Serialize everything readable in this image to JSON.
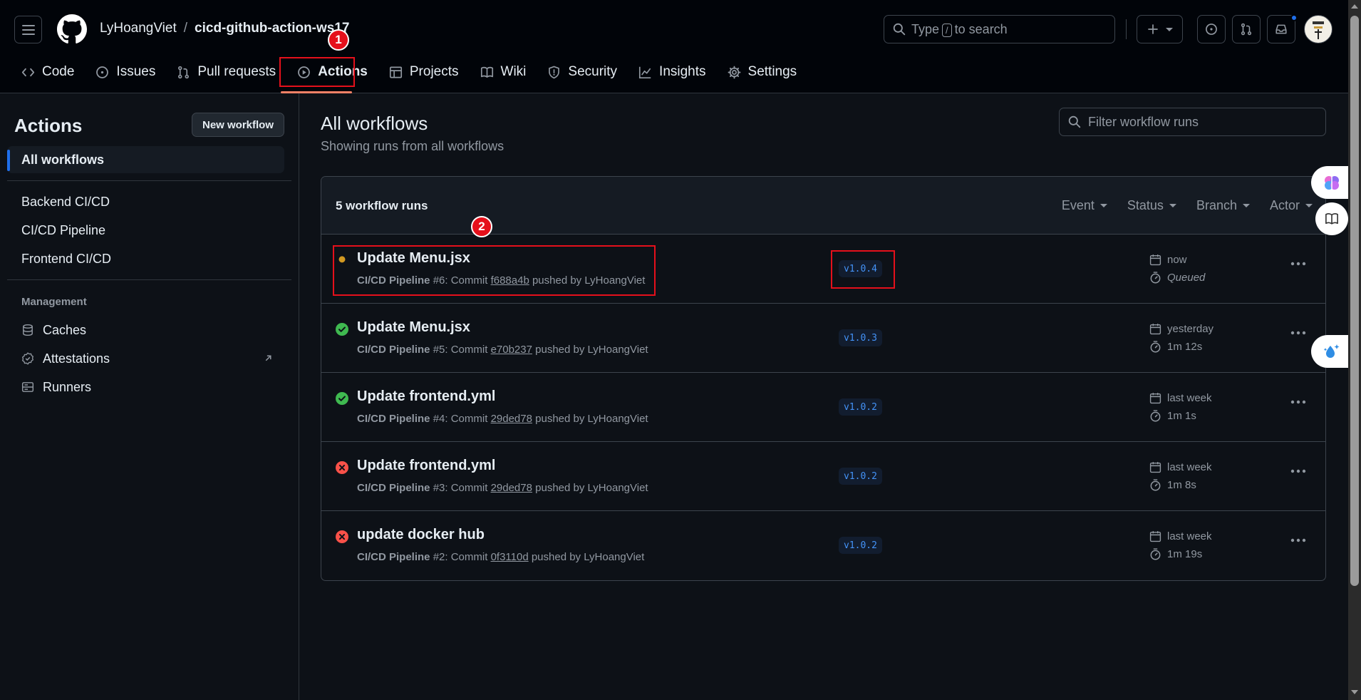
{
  "header": {
    "owner": "LyHoangViet",
    "separator": "/",
    "repo": "cicd-github-action-ws17",
    "search_text_before": "Type",
    "search_key": "/",
    "search_text_after": "to search"
  },
  "tabs": [
    {
      "label": "Code",
      "icon": "code-icon"
    },
    {
      "label": "Issues",
      "icon": "issue-icon"
    },
    {
      "label": "Pull requests",
      "icon": "pull-request-icon"
    },
    {
      "label": "Actions",
      "icon": "play-icon"
    },
    {
      "label": "Projects",
      "icon": "table-icon"
    },
    {
      "label": "Wiki",
      "icon": "book-icon"
    },
    {
      "label": "Security",
      "icon": "shield-icon"
    },
    {
      "label": "Insights",
      "icon": "graph-icon"
    },
    {
      "label": "Settings",
      "icon": "gear-icon"
    }
  ],
  "active_tab": "Actions",
  "annotations": {
    "marker1": "1",
    "marker2": "2",
    "color": "#e5101b"
  },
  "sidebar": {
    "title": "Actions",
    "new_workflow": "New workflow",
    "all_workflows": "All workflows",
    "workflows": [
      "Backend CI/CD",
      "CI/CD Pipeline",
      "Frontend CI/CD"
    ],
    "management_heading": "Management",
    "management": [
      {
        "label": "Caches",
        "icon": "database-icon"
      },
      {
        "label": "Attestations",
        "icon": "verified-icon"
      },
      {
        "label": "Runners",
        "icon": "server-icon"
      }
    ]
  },
  "main": {
    "title": "All workflows",
    "subtitle": "Showing runs from all workflows",
    "filter_placeholder": "Filter workflow runs",
    "runs_count": "5 workflow runs",
    "filters": [
      "Event",
      "Status",
      "Branch",
      "Actor"
    ],
    "runs": [
      {
        "status": "queued",
        "title": "Update Menu.jsx",
        "workflow": "CI/CD Pipeline",
        "meta_mid": " #6: Commit ",
        "sha": "f688a4b",
        "meta_end": " pushed by LyHoangViet",
        "branch": "v1.0.4",
        "when": "now",
        "duration": "Queued"
      },
      {
        "status": "success",
        "title": "Update Menu.jsx",
        "workflow": "CI/CD Pipeline",
        "meta_mid": " #5: Commit ",
        "sha": "e70b237",
        "meta_end": " pushed by LyHoangViet",
        "branch": "v1.0.3",
        "when": "yesterday",
        "duration": "1m 12s"
      },
      {
        "status": "success",
        "title": "Update frontend.yml",
        "workflow": "CI/CD Pipeline",
        "meta_mid": " #4: Commit ",
        "sha": "29ded78",
        "meta_end": " pushed by LyHoangViet",
        "branch": "v1.0.2",
        "when": "last week",
        "duration": "1m 1s"
      },
      {
        "status": "failure",
        "title": "Update frontend.yml",
        "workflow": "CI/CD Pipeline",
        "meta_mid": " #3: Commit ",
        "sha": "29ded78",
        "meta_end": " pushed by LyHoangViet",
        "branch": "v1.0.2",
        "when": "last week",
        "duration": "1m 8s"
      },
      {
        "status": "failure",
        "title": "update docker hub",
        "workflow": "CI/CD Pipeline",
        "meta_mid": " #2: Commit ",
        "sha": "0f3110d",
        "meta_end": " pushed by LyHoangViet",
        "branch": "v1.0.2",
        "when": "last week",
        "duration": "1m 19s"
      }
    ]
  },
  "colors": {
    "success": "#3fb950",
    "failure": "#f85149",
    "queued": "#d29922",
    "link": "#4493f8",
    "accent": "#f78166"
  }
}
